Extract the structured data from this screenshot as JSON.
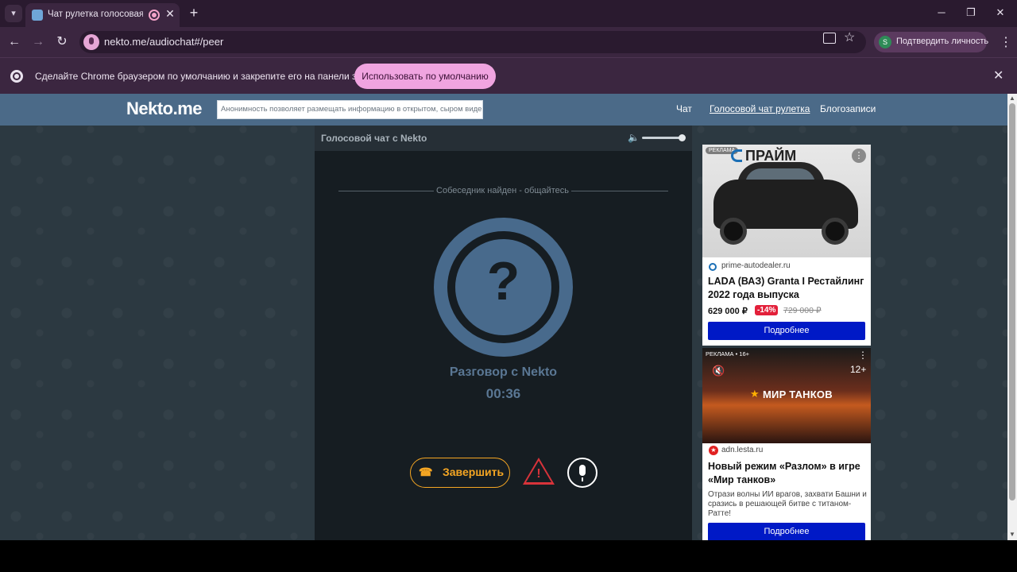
{
  "browser": {
    "tab_title": "Чат рулетка голосовая — N",
    "url": "nekto.me/audiochat#/peer",
    "profile_label": "Подтвердить личность",
    "profile_initial": "S",
    "infobar_text": "Сделайте Chrome браузером по умолчанию и закрепите его на панели задач.",
    "infobar_button": "Использовать по умолчанию"
  },
  "site": {
    "logo": "Nekto.me",
    "slogan": "Анонимность позволяет размещать информацию в открытом, сыром виде!",
    "nav": [
      "Чат",
      "Голосовой чат рулетка",
      "Блогозаписи"
    ]
  },
  "chat": {
    "header_title": "Голосовой чат с Nekto",
    "status": "Собеседник найден - общайтесь",
    "avatar_symbol": "?",
    "talk_label": "Разговор с Nekto",
    "timer": "00:36",
    "end_button": "Завершить"
  },
  "ads": [
    {
      "badge": "РЕКЛАМА",
      "brand": "ПРАЙМ",
      "domain": "prime-autodealer.ru",
      "title": "LADA (ВАЗ) Granta I Рестайлинг 2022 года выпуска",
      "price": "629 000 ₽",
      "discount": "-14%",
      "old_price": "729 000 ₽",
      "cta": "Подробнее"
    },
    {
      "badge": "РЕКЛАМА • 16+",
      "age": "12+",
      "game": "МИР ТАНКОВ",
      "domain": "adn.lesta.ru",
      "title": "Новый режим «Разлом» в игре «Мир танков»",
      "desc": "Отрази волны ИИ врагов, захвати Башни и сразись в решающей битве с титаном-Ратте!",
      "cta": "Подробнее"
    }
  ]
}
